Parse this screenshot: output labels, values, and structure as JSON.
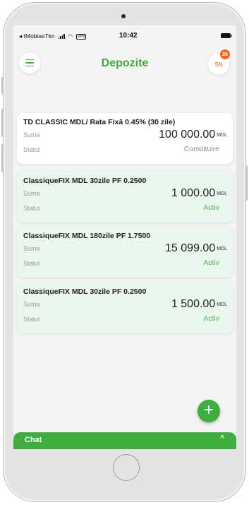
{
  "status_bar": {
    "carrier": "◂ tMobiasTkn",
    "vpn": "VPN",
    "time": "10:42"
  },
  "header": {
    "title": "Depozite",
    "avatar_initials": "SN",
    "notification_count": "26"
  },
  "deposits": [
    {
      "name": "TD CLASSIC MDL/ Rata Fixă 0.45% (30 zile)",
      "amount_label": "Suma",
      "amount": "100 000.00",
      "currency": "MDL",
      "status_label": "Statut",
      "status": "Constituire"
    },
    {
      "name": "ClassiqueFIX MDL 30zile PF 0.2500",
      "amount_label": "Suma",
      "amount": "1 000.00",
      "currency": "MDL",
      "status_label": "Statut",
      "status": "Activ"
    },
    {
      "name": "ClassiqueFIX MDL 180zile PF 1.7500",
      "amount_label": "Suma",
      "amount": "15 099.00",
      "currency": "MDL",
      "status_label": "Statut",
      "status": "Activ"
    },
    {
      "name": "ClassiqueFIX MDL 30zile PF 0.2500",
      "amount_label": "Suma",
      "amount": "1 500.00",
      "currency": "MDL",
      "status_label": "Statut",
      "status": "Activ"
    }
  ],
  "fab": {
    "symbol": "+"
  },
  "chat": {
    "label": "Chat",
    "toggle_symbol": "^"
  },
  "colors": {
    "brand_green": "#3fae3f",
    "badge_orange": "#f0671f",
    "card_active_bg": "#eaf6ee",
    "card_pending_bg": "#ffffff"
  },
  "icons": {
    "menu": "hamburger-menu-icon",
    "add": "plus-icon",
    "chat_toggle": "chevron-up-icon"
  }
}
